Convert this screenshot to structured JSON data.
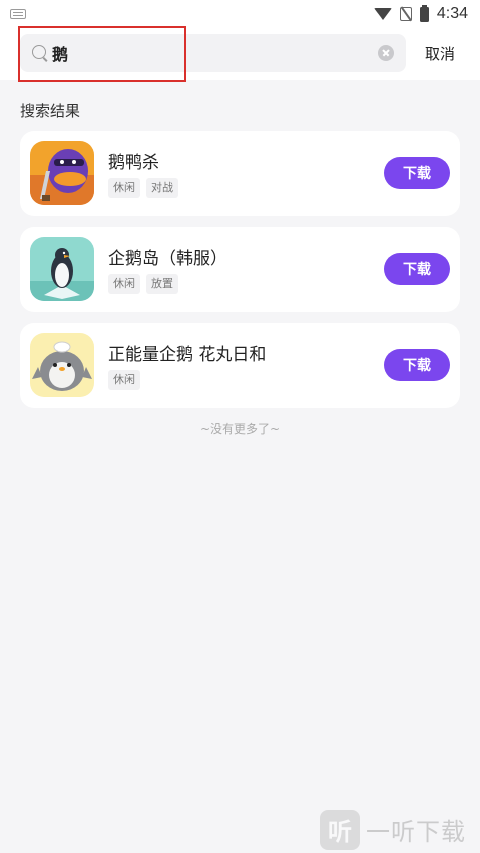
{
  "status_bar": {
    "time": "4:34"
  },
  "search": {
    "query": "鹅",
    "cancel_label": "取消"
  },
  "section_title": "搜索结果",
  "results": [
    {
      "name": "鹅鸭杀",
      "tags": [
        "休闲",
        "对战"
      ],
      "download_label": "下载"
    },
    {
      "name": "企鹅岛（韩服）",
      "tags": [
        "休闲",
        "放置"
      ],
      "download_label": "下载"
    },
    {
      "name": "正能量企鹅 花丸日和",
      "tags": [
        "休闲"
      ],
      "download_label": "下载"
    }
  ],
  "end_text": "~没有更多了~",
  "watermark": {
    "logo_glyph": "听",
    "text": "一听下载"
  },
  "colors": {
    "accent": "#7b46ee",
    "highlight": "#d9302c",
    "background": "#f5f5f7"
  },
  "icons": [
    "keyboard-icon",
    "wifi-icon",
    "no-sim-icon",
    "battery-icon",
    "search-icon",
    "clear-icon"
  ]
}
